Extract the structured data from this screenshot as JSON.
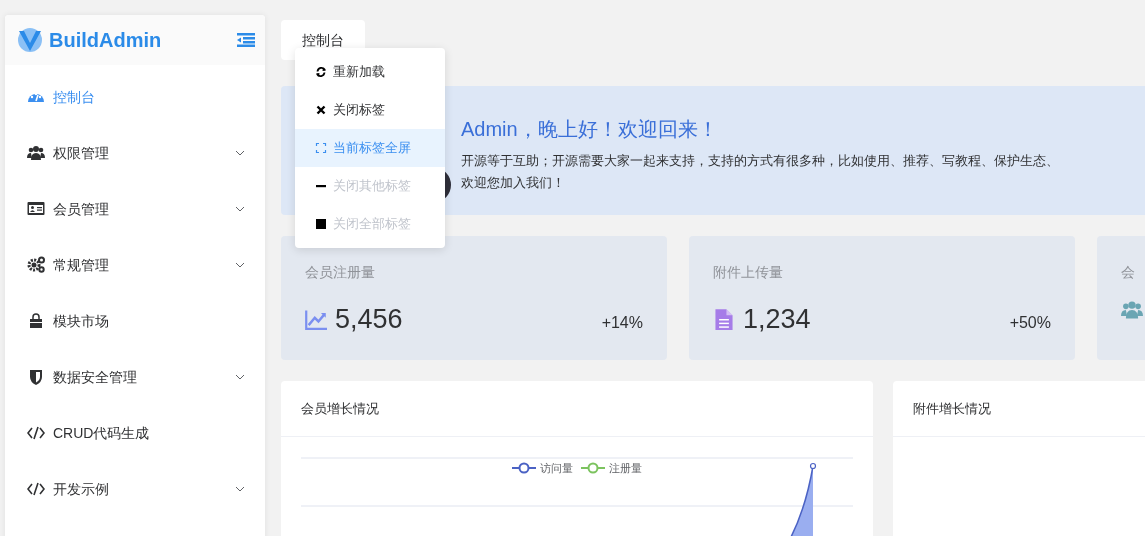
{
  "sidebar": {
    "logo": "BuildAdmin",
    "items": [
      {
        "label": "控制台",
        "selected": true,
        "expandable": false
      },
      {
        "label": "权限管理",
        "selected": false,
        "expandable": true
      },
      {
        "label": "会员管理",
        "selected": false,
        "expandable": true
      },
      {
        "label": "常规管理",
        "selected": false,
        "expandable": true
      },
      {
        "label": "模块市场",
        "selected": false,
        "expandable": false
      },
      {
        "label": "数据安全管理",
        "selected": false,
        "expandable": true
      },
      {
        "label": "CRUD代码生成",
        "selected": false,
        "expandable": false
      },
      {
        "label": "开发示例",
        "selected": false,
        "expandable": true
      }
    ]
  },
  "tabs": [
    {
      "label": "控制台"
    }
  ],
  "context_menu": [
    {
      "label": "重新加载",
      "selected": false,
      "disabled": false
    },
    {
      "label": "关闭标签",
      "selected": false,
      "disabled": false
    },
    {
      "label": "当前标签全屏",
      "selected": true,
      "disabled": false
    },
    {
      "label": "关闭其他标签",
      "selected": false,
      "disabled": true
    },
    {
      "label": "关闭全部标签",
      "selected": false,
      "disabled": true
    }
  ],
  "welcome": {
    "title": "Admin，晚上好！欢迎回来！",
    "lines": [
      "开源等于互助；开源需要大家一起来支持，支持的方式有很多种，比如使用、推荐、写教程、保护生态、",
      "欢迎您加入我们！"
    ]
  },
  "stats": [
    {
      "title": "会员注册量",
      "color": "#7b8ff0",
      "value": "5,456",
      "change": "+14%"
    },
    {
      "title": "附件上传量",
      "color": "#a67ce8",
      "value": "1,234",
      "change": "+50%"
    },
    {
      "title": "会",
      "color": "#6aa5b3"
    }
  ],
  "charts": [
    {
      "title": "会员增长情况",
      "legend": [
        {
          "name": "访问量",
          "color": "#4b62c4"
        },
        {
          "name": "注册量",
          "color": "#7cc35f"
        }
      ]
    },
    {
      "title": "附件增长情况"
    }
  ]
}
